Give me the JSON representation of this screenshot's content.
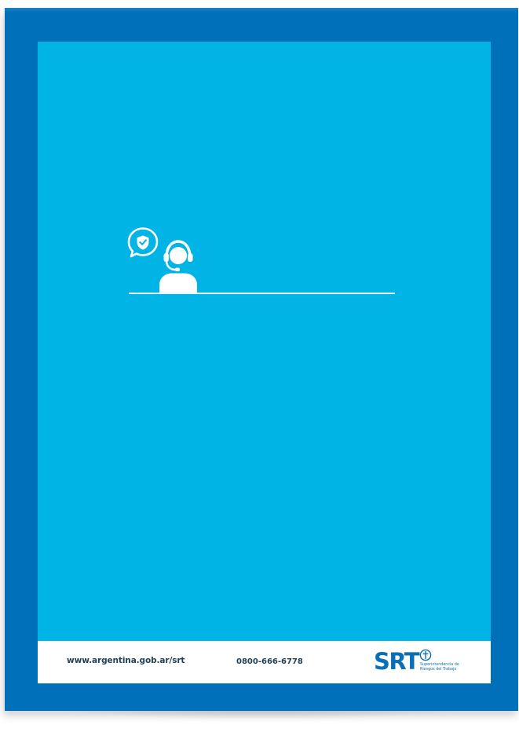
{
  "poster": {
    "background_color": "#00b5e6",
    "frame_color": "#0170bb",
    "icons": {
      "speech_bubble": "shield-check-speech-bubble-icon",
      "agent": "headset-agent-icon"
    }
  },
  "footer": {
    "url": "www.argentina.gob.ar/srt",
    "phone": "0800-666-6778",
    "logo": {
      "mark": "SRT",
      "line1": "Superintendencia de",
      "line2": "Riesgos del Trabajo",
      "color": "#0a6fb7"
    }
  }
}
